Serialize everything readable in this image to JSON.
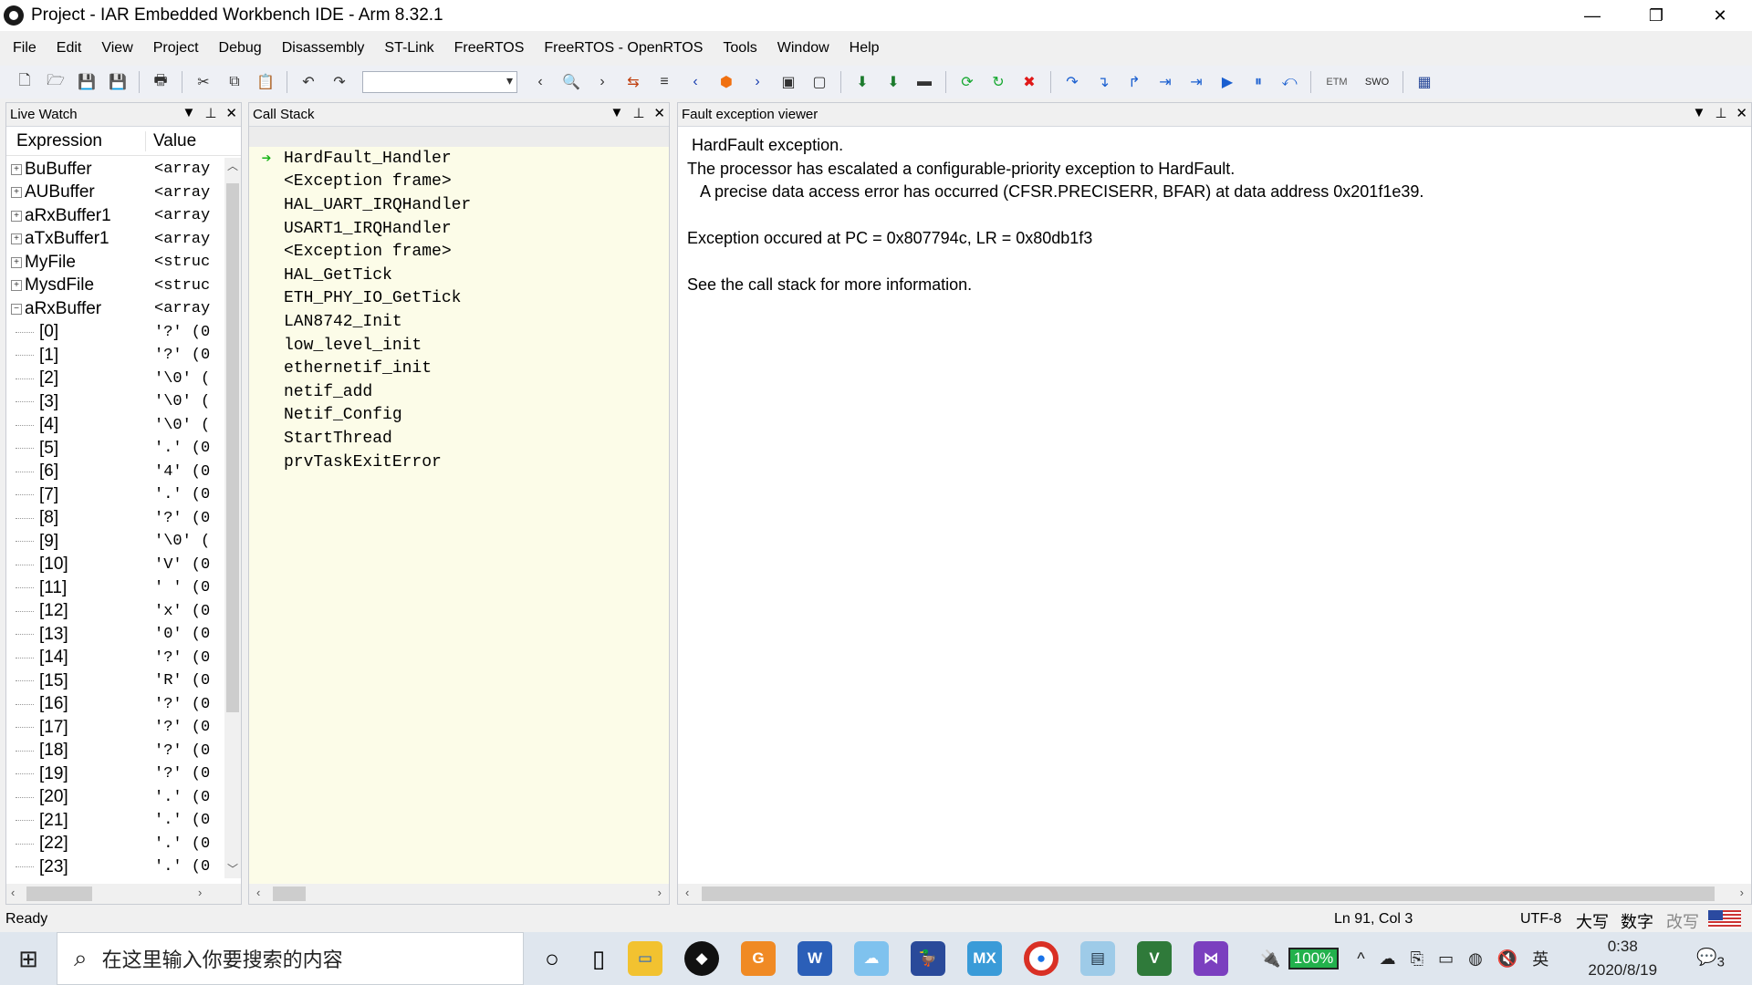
{
  "window": {
    "title": "Project - IAR Embedded Workbench IDE - Arm 8.32.1",
    "min": "—",
    "restore": "❐",
    "close": "✕"
  },
  "menu": [
    "File",
    "Edit",
    "View",
    "Project",
    "Debug",
    "Disassembly",
    "ST-Link",
    "FreeRTOS",
    "FreeRTOS - OpenRTOS",
    "Tools",
    "Window",
    "Help"
  ],
  "toolbar": {
    "etm_label": "ETM",
    "swo_label": "SWO",
    "search_value": ""
  },
  "live_watch": {
    "title": "Live Watch",
    "col_expression": "Expression",
    "col_value": "Value",
    "rows": [
      {
        "expr": "BuBuffer",
        "val": "<array",
        "expand": "+"
      },
      {
        "expr": "AUBuffer",
        "val": "<array",
        "expand": "+"
      },
      {
        "expr": "aRxBuffer1",
        "val": "<array",
        "expand": "+"
      },
      {
        "expr": "aTxBuffer1",
        "val": "<array",
        "expand": "+"
      },
      {
        "expr": "MyFile",
        "val": "<struc",
        "expand": "+"
      },
      {
        "expr": "MysdFile",
        "val": "<struc",
        "expand": "+"
      },
      {
        "expr": "aRxBuffer",
        "val": "<array",
        "expand": "−"
      },
      {
        "expr": "[0]",
        "val": "'?' (0"
      },
      {
        "expr": "[1]",
        "val": "'?' (0"
      },
      {
        "expr": "[2]",
        "val": "'\\0' ("
      },
      {
        "expr": "[3]",
        "val": "'\\0' ("
      },
      {
        "expr": "[4]",
        "val": "'\\0' ("
      },
      {
        "expr": "[5]",
        "val": "'.' (0"
      },
      {
        "expr": "[6]",
        "val": "'4' (0"
      },
      {
        "expr": "[7]",
        "val": "'.' (0"
      },
      {
        "expr": "[8]",
        "val": "'?' (0"
      },
      {
        "expr": "[9]",
        "val": "'\\0' ("
      },
      {
        "expr": "[10]",
        "val": "'V' (0"
      },
      {
        "expr": "[11]",
        "val": "' ' (0"
      },
      {
        "expr": "[12]",
        "val": "'x' (0"
      },
      {
        "expr": "[13]",
        "val": "'0' (0"
      },
      {
        "expr": "[14]",
        "val": "'?' (0"
      },
      {
        "expr": "[15]",
        "val": "'R' (0"
      },
      {
        "expr": "[16]",
        "val": "'?' (0"
      },
      {
        "expr": "[17]",
        "val": "'?' (0"
      },
      {
        "expr": "[18]",
        "val": "'?' (0"
      },
      {
        "expr": "[19]",
        "val": "'?' (0"
      },
      {
        "expr": "[20]",
        "val": "'.' (0"
      },
      {
        "expr": "[21]",
        "val": "'.' (0"
      },
      {
        "expr": "[22]",
        "val": "'.' (0"
      },
      {
        "expr": "[23]",
        "val": "'.' (0"
      }
    ]
  },
  "call_stack": {
    "title": "Call Stack",
    "frames": [
      "HardFault_Handler",
      "<Exception frame>",
      "HAL_UART_IRQHandler",
      "USART1_IRQHandler",
      "<Exception frame>",
      "HAL_GetTick",
      "ETH_PHY_IO_GetTick",
      "LAN8742_Init",
      "low_level_init",
      "ethernetif_init",
      "netif_add",
      "Netif_Config",
      "StartThread",
      "prvTaskExitError"
    ]
  },
  "fault_viewer": {
    "title": "Fault exception viewer",
    "lines": [
      " HardFault exception.",
      "The processor has escalated a configurable-priority exception to HardFault.",
      "   A precise data access error has occurred (CFSR.PRECISERR, BFAR) at data address 0x201f1e39.",
      "",
      "Exception occured at PC = 0x807794c, LR = 0x80db1f3",
      "",
      "See the call stack for more information."
    ]
  },
  "status": {
    "ready": "Ready",
    "position": "Ln 91, Col 3",
    "encoding": "UTF-8",
    "caps": "大写",
    "num": "数字",
    "ovr": "改写"
  },
  "taskbar": {
    "search_placeholder": "在这里输入你要搜索的内容",
    "battery": "100%",
    "ime": "英",
    "time": "0:38",
    "date": "2020/8/19",
    "notifications": "3"
  }
}
